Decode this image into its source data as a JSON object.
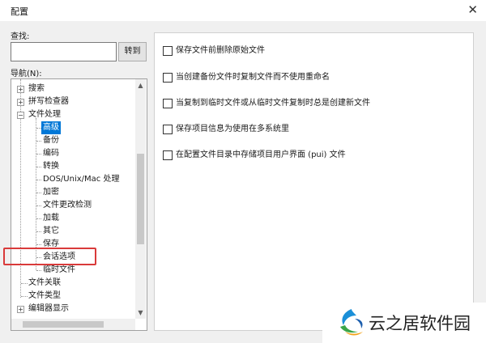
{
  "window": {
    "title": "配置",
    "close_glyph": "✕"
  },
  "search": {
    "label": "查找:",
    "value": "",
    "goto_label": "转到"
  },
  "nav": {
    "label": "导航(N):",
    "items": [
      {
        "label": "搜索",
        "expander": "+",
        "selected": false
      },
      {
        "label": "拼写检查器",
        "expander": "+",
        "selected": false
      },
      {
        "label": "文件处理",
        "expander": "−",
        "selected": false
      },
      {
        "label": "高级",
        "selected": true
      },
      {
        "label": "备份",
        "selected": false
      },
      {
        "label": "编码",
        "selected": false
      },
      {
        "label": "转换",
        "selected": false
      },
      {
        "label": "DOS/Unix/Mac 处理",
        "selected": false
      },
      {
        "label": "加密",
        "selected": false
      },
      {
        "label": "文件更改检测",
        "selected": false
      },
      {
        "label": "加载",
        "selected": false
      },
      {
        "label": "其它",
        "selected": false
      },
      {
        "label": "保存",
        "selected": false
      },
      {
        "label": "会话选项",
        "selected": false,
        "highlighted": true
      },
      {
        "label": "临时文件",
        "selected": false
      },
      {
        "label": "文件关联",
        "selected": false
      },
      {
        "label": "文件类型",
        "selected": false
      },
      {
        "label": "编辑器显示",
        "expander": "+",
        "selected": false
      }
    ]
  },
  "options": [
    {
      "label": "保存文件前删除原始文件",
      "checked": false
    },
    {
      "label": "当创建备份文件时复制文件而不使用重命名",
      "checked": false
    },
    {
      "label": "当复制到临时文件或从临时文件复制时总是创建新文件",
      "checked": false
    },
    {
      "label": "保存项目信息为使用在多系统里",
      "checked": false
    },
    {
      "label": "在配置文件目录中存储项目用户界面 (pui) 文件",
      "checked": false
    }
  ],
  "watermark": {
    "text": "云之居软件园"
  },
  "colors": {
    "selection": "#0078d7",
    "highlight_box": "#d93a3a",
    "dialog_bg": "#f0f0f0"
  }
}
